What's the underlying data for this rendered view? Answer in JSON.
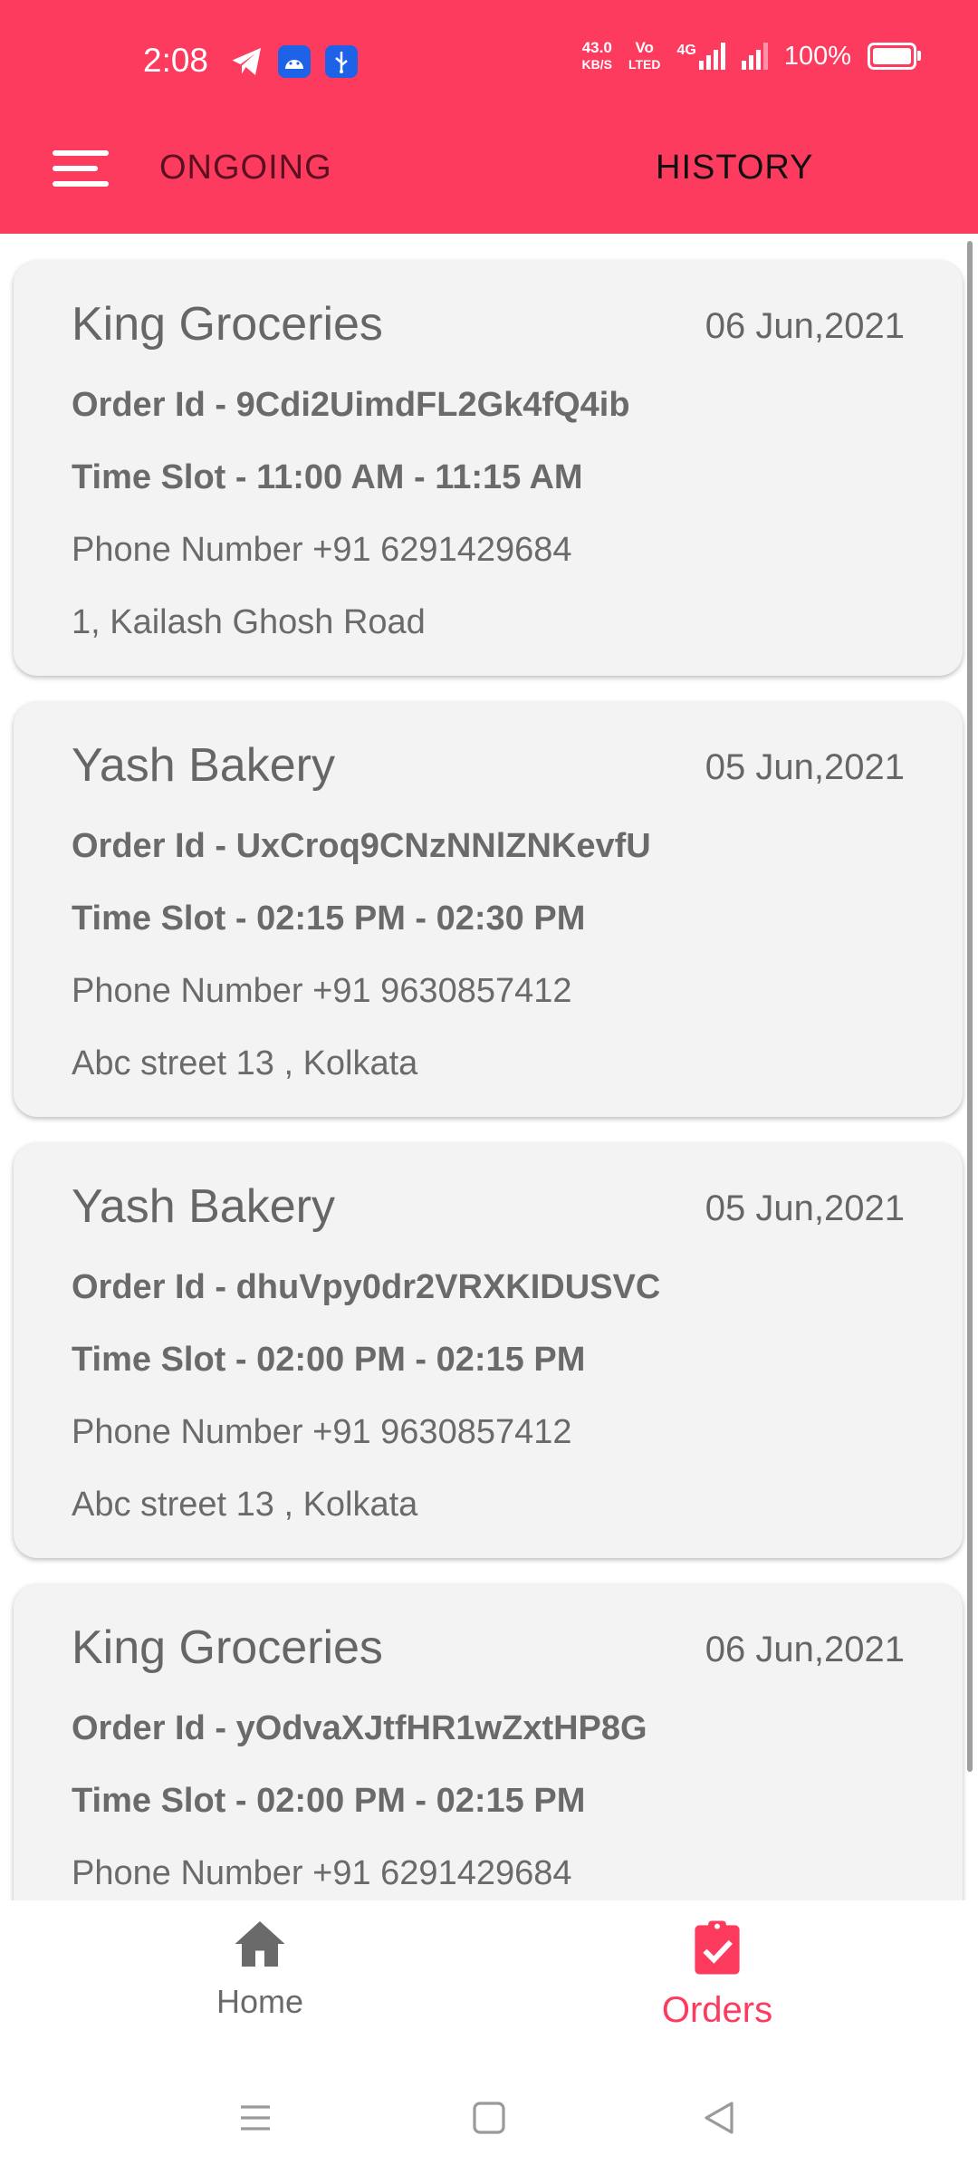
{
  "status_bar": {
    "time": "2:08",
    "net_speed_value": "43.0",
    "net_speed_unit": "KB/S",
    "volte": "Vo",
    "volte_sub": "LTED",
    "network": "4G",
    "battery": "100%"
  },
  "header": {
    "tabs": [
      {
        "label": "ONGOING"
      },
      {
        "label": "HISTORY"
      }
    ],
    "colors": {
      "accent": "#fd3b5f"
    }
  },
  "orders": [
    {
      "store": "King Groceries",
      "date": "06 Jun,2021",
      "order_id": "Order Id - 9Cdi2UimdFL2Gk4fQ4ib",
      "time_slot": "Time Slot - 11:00 AM - 11:15 AM",
      "phone": "Phone Number  +91 6291429684",
      "address": "1, Kailash Ghosh Road"
    },
    {
      "store": "Yash Bakery",
      "date": "05 Jun,2021",
      "order_id": "Order Id - UxCroq9CNzNNlZNKevfU",
      "time_slot": "Time Slot - 02:15 PM - 02:30 PM",
      "phone": "Phone Number  +91 9630857412",
      "address": "Abc street 13 , Kolkata"
    },
    {
      "store": "Yash Bakery",
      "date": "05 Jun,2021",
      "order_id": "Order Id - dhuVpy0dr2VRXKIDUSVC",
      "time_slot": "Time Slot - 02:00 PM - 02:15 PM",
      "phone": "Phone Number  +91 9630857412",
      "address": "Abc street 13 , Kolkata"
    },
    {
      "store": "King Groceries",
      "date": "06 Jun,2021",
      "order_id": "Order Id - yOdvaXJtfHR1wZxtHP8G",
      "time_slot": "Time Slot - 02:00 PM - 02:15 PM",
      "phone": "Phone Number  +91 6291429684",
      "address": ""
    }
  ],
  "bottom_nav": {
    "items": [
      {
        "label": "Home",
        "icon": "home-icon"
      },
      {
        "label": "Orders",
        "icon": "orders-icon",
        "active": true
      }
    ]
  }
}
